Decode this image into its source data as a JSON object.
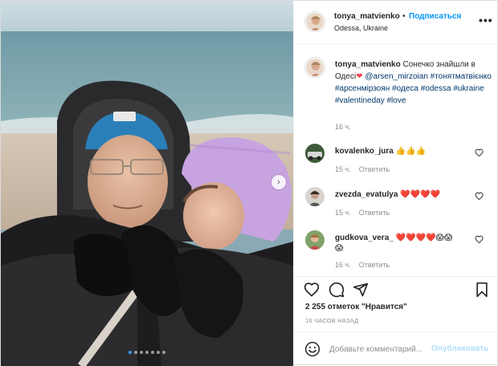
{
  "post": {
    "username": "tonya_matvienko",
    "follow_label": "Подписаться",
    "separator": "•",
    "location": "Odessa, Ukraine",
    "more_label": "•••",
    "caption_text": "Сонечко знайшли в Одесі",
    "caption_heart": "❤",
    "caption_mention": "@arsen_mirzoian",
    "hashtags": [
      "#тонятматвієнко",
      "#арсенмірзоян",
      "#одеса",
      "#odessa",
      "#ukraine",
      "#valentineday",
      "#love"
    ],
    "caption_time": "16 ч.",
    "likes": "2 255 отметок \"Нравится\"",
    "posted_ago": "16 ЧАСОВ НАЗАД",
    "next_label": "›",
    "carousel_count": 7
  },
  "comments": [
    {
      "username": "kovalenko_jura",
      "text": "👍👍👍",
      "time": "15 ч.",
      "reply": "Ответить"
    },
    {
      "username": "zvezda_evatulya",
      "text": "❤️❤️❤️❤️",
      "time": "15 ч.",
      "reply": "Ответить"
    },
    {
      "username": "gudkova_vera_",
      "text": "❤️❤️❤️❤️😱😱",
      "text_line2": "😱",
      "time": "16 ч.",
      "reply": "Ответить"
    }
  ],
  "add_comment": {
    "placeholder": "Добавьте комментарий...",
    "publish_label": "Опубликовать"
  },
  "colors": {
    "accent": "#0095f6",
    "hashtag": "#00376b",
    "muted": "#8e8e8e",
    "publish_disabled": "#b2dffc",
    "hat_lilac": "#c7a3e0",
    "hat_blue": "#2b7fb8"
  },
  "icons": [
    "heart-icon",
    "comment-icon",
    "share-icon",
    "bookmark-icon",
    "emoji-icon",
    "like-comment-icon",
    "next-arrow-icon"
  ]
}
